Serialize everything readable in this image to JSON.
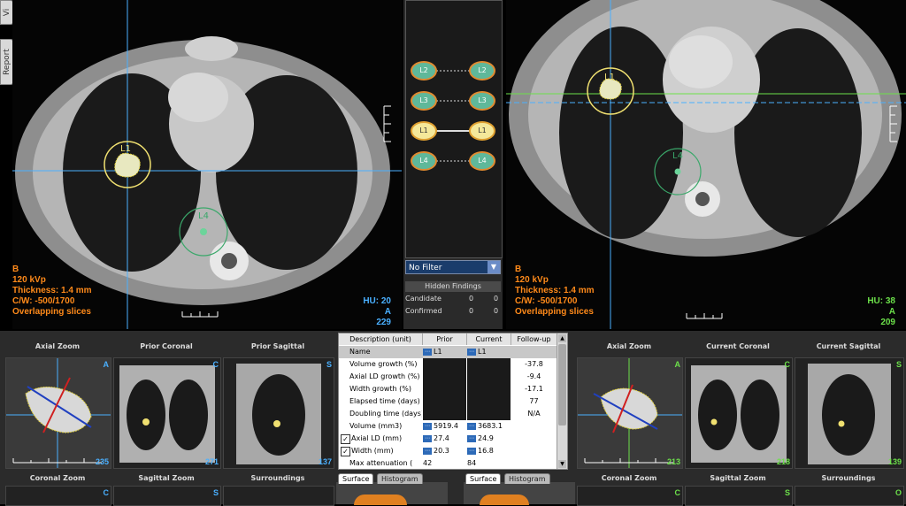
{
  "side_tabs": {
    "viewer": "Vi",
    "report": "Report"
  },
  "prior_view": {
    "overlay": [
      "B",
      "120 kVp",
      "Thickness: 1.4 mm",
      "C/W: -500/1700",
      "Overlapping slices"
    ],
    "hu_label": "HU:",
    "hu_value": "20",
    "orientation": "A",
    "slice": "229",
    "lesions": {
      "l1": "L1",
      "l4": "L4"
    }
  },
  "current_view": {
    "overlay": [
      "B",
      "120 kVp",
      "Thickness: 1.4 mm",
      "C/W: -500/1700",
      "Overlapping slices"
    ],
    "hu_label": "HU:",
    "hu_value": "38",
    "orientation": "A",
    "slice": "209",
    "lesions": {
      "l1": "L1",
      "l4": "L4"
    }
  },
  "matching": {
    "pairs": [
      {
        "left": "L2",
        "right": "L2"
      },
      {
        "left": "L3",
        "right": "L3"
      },
      {
        "left": "L1",
        "right": "L1"
      },
      {
        "left": "L4",
        "right": "L4"
      }
    ],
    "filter": "No Filter",
    "hidden_title": "Hidden Findings",
    "hidden_rows": [
      {
        "label": "Candidate",
        "a": "0",
        "b": "0"
      },
      {
        "label": "Confirmed",
        "a": "0",
        "b": "0"
      }
    ]
  },
  "prior_panels": {
    "axial_zoom": {
      "title": "Axial Zoom",
      "corner": "A",
      "slice": "235"
    },
    "coronal": {
      "title": "Prior Coronal",
      "corner": "C",
      "slice": "271"
    },
    "sagittal": {
      "title": "Prior Sagittal",
      "corner": "S",
      "slice": "137"
    },
    "coronal_zoom": {
      "title": "Coronal Zoom",
      "corner": "C"
    },
    "sagittal_zoom": {
      "title": "Sagittal Zoom",
      "corner": "S"
    },
    "surroundings": {
      "title": "Surroundings"
    }
  },
  "current_panels": {
    "axial_zoom": {
      "title": "Axial Zoom",
      "corner": "A",
      "slice": "213"
    },
    "coronal": {
      "title": "Current Coronal",
      "corner": "C",
      "slice": "218"
    },
    "sagittal": {
      "title": "Current Sagittal",
      "corner": "S",
      "slice": "139"
    },
    "coronal_zoom": {
      "title": "Coronal Zoom",
      "corner": "C"
    },
    "sagittal_zoom": {
      "title": "Sagittal Zoom",
      "corner": "S"
    },
    "surroundings": {
      "title": "Surroundings",
      "corner": "O"
    }
  },
  "table": {
    "headers": [
      "Description (unit)",
      "Prior",
      "Current",
      "Follow-up"
    ],
    "rows": [
      {
        "label": "Name",
        "prior": "L1",
        "current": "L1",
        "followup": ""
      },
      {
        "label": "Volume growth (%)",
        "prior": "",
        "current": "",
        "followup": "-37.8"
      },
      {
        "label": "Axial LD growth (%)",
        "prior": "",
        "current": "",
        "followup": "-9.4"
      },
      {
        "label": "Width growth (%)",
        "prior": "",
        "current": "",
        "followup": "-17.1"
      },
      {
        "label": "Elapsed time (days)",
        "prior": "",
        "current": "",
        "followup": "77"
      },
      {
        "label": "Doubling time (days)",
        "prior": "",
        "current": "",
        "followup": "N/A"
      },
      {
        "label": "Volume (mm3)",
        "prior": "5919.4",
        "current": "3683.1",
        "followup": ""
      },
      {
        "label": "Axial LD (mm)",
        "prior": "27.4",
        "current": "24.9",
        "followup": ""
      },
      {
        "label": "Width (mm)",
        "prior": "20.3",
        "current": "16.8",
        "followup": ""
      },
      {
        "label": "Max attenuation (",
        "prior": "42",
        "current": "84",
        "followup": ""
      }
    ]
  },
  "render_tabs": {
    "prior": {
      "surface": "Surface",
      "histogram": "Histogram"
    },
    "current": {
      "surface": "Surface",
      "histogram": "Histogram"
    }
  },
  "colors": {
    "overlay_orange": "#ff8a1a",
    "hu_prior": "#4ab0ff",
    "hu_current": "#6ce04a",
    "lesion_yellow": "#f0e070",
    "lesion_green": "#3aa86a"
  }
}
